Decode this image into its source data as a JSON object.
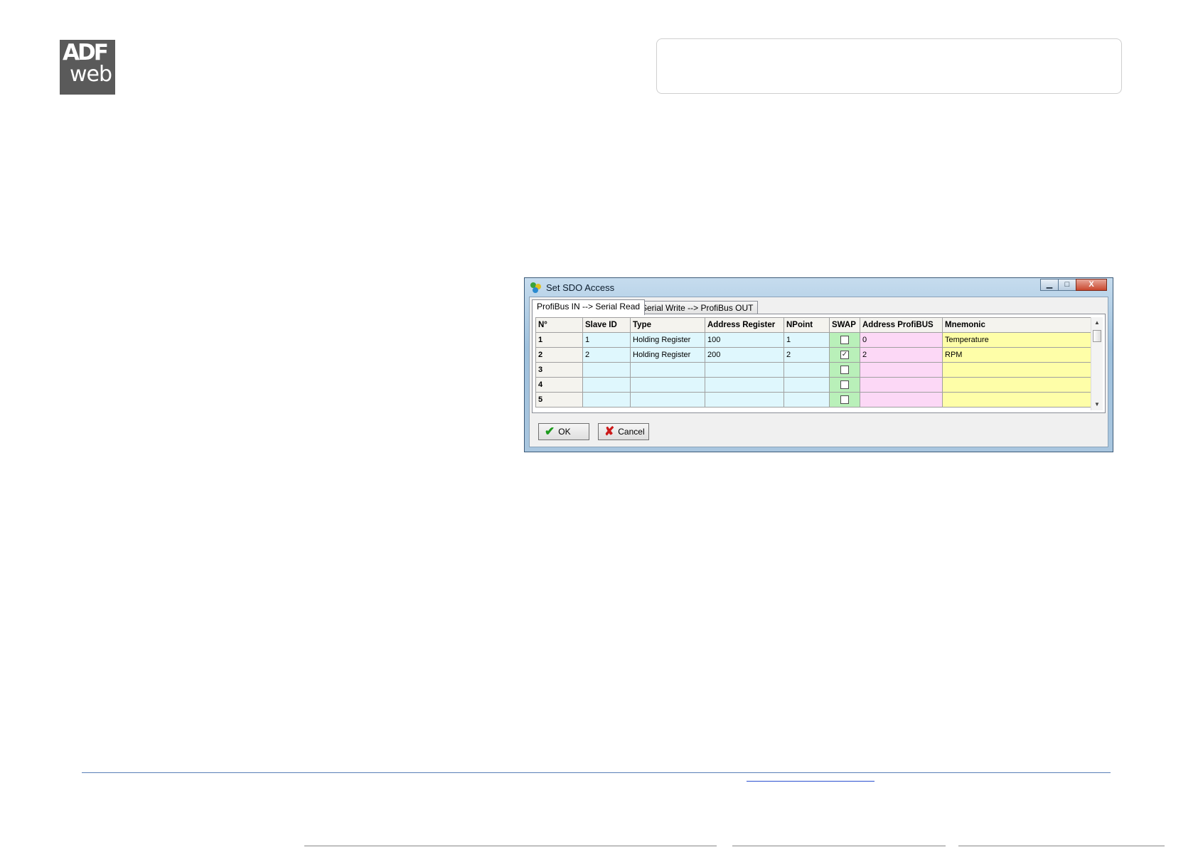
{
  "logo": {
    "line1": "ADF",
    "line2": "web"
  },
  "window": {
    "title": "Set SDO Access",
    "controls": {
      "minimize": "▁",
      "maximize": "□",
      "close": "X"
    }
  },
  "tabs": [
    {
      "label": "ProfiBus IN --> Serial Read",
      "active": true
    },
    {
      "label": "Serial Write --> ProfiBus OUT",
      "active": false
    }
  ],
  "table": {
    "headers": [
      "N°",
      "Slave ID",
      "Type",
      "Address Register",
      "NPoint",
      "SWAP",
      "Address ProfiBUS",
      "Mnemonic"
    ],
    "rows": [
      {
        "n": "1",
        "slave_id": "1",
        "type": "Holding Register",
        "address_register": "100",
        "npoint": "1",
        "swap": false,
        "address_profibus": "0",
        "mnemonic": "Temperature"
      },
      {
        "n": "2",
        "slave_id": "2",
        "type": "Holding Register",
        "address_register": "200",
        "npoint": "2",
        "swap": true,
        "address_profibus": "2",
        "mnemonic": "RPM"
      },
      {
        "n": "3",
        "slave_id": "",
        "type": "",
        "address_register": "",
        "npoint": "",
        "swap": false,
        "address_profibus": "",
        "mnemonic": ""
      },
      {
        "n": "4",
        "slave_id": "",
        "type": "",
        "address_register": "",
        "npoint": "",
        "swap": false,
        "address_profibus": "",
        "mnemonic": ""
      },
      {
        "n": "5",
        "slave_id": "",
        "type": "",
        "address_register": "",
        "npoint": "",
        "swap": false,
        "address_profibus": "",
        "mnemonic": ""
      }
    ]
  },
  "buttons": {
    "ok": "OK",
    "cancel": "Cancel"
  },
  "colors": {
    "slave_columns": "#dff7fd",
    "swap_column": "#b9f0b9",
    "profibus_column": "#fcd8f6",
    "mnemonic_column": "#fefea8"
  }
}
